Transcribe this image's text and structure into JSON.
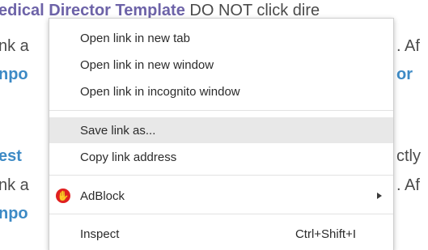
{
  "page": {
    "line1": {
      "link_text": "edical Director Template",
      "tail_text": " DO NOT click dire"
    },
    "line2": {
      "lead_text": "nk a",
      "tail_text": ". Af"
    },
    "line3": {
      "lead_link_text": "npo",
      "tail_link_text": "or"
    },
    "line4": {
      "lead_link_text": "est",
      "tail_text": "ctly"
    },
    "line5": {
      "lead_text": "nk a",
      "tail_text": ". Af"
    },
    "line6": {
      "lead_link_text": "npo"
    }
  },
  "context_menu": {
    "items": [
      {
        "label": "Open link in new tab"
      },
      {
        "label": "Open link in new window"
      },
      {
        "label": "Open link in incognito window"
      },
      {
        "label": "Save link as..."
      },
      {
        "label": "Copy link address"
      },
      {
        "label": "AdBlock",
        "icon": "adblock-icon"
      },
      {
        "label": "Inspect",
        "shortcut": "Ctrl+Shift+I"
      }
    ]
  },
  "colors": {
    "purple_link": "#6d63a8",
    "blue_link": "#3f7fbf",
    "menu_highlight": "#e8e8e8",
    "adblock_red": "#e02020"
  }
}
